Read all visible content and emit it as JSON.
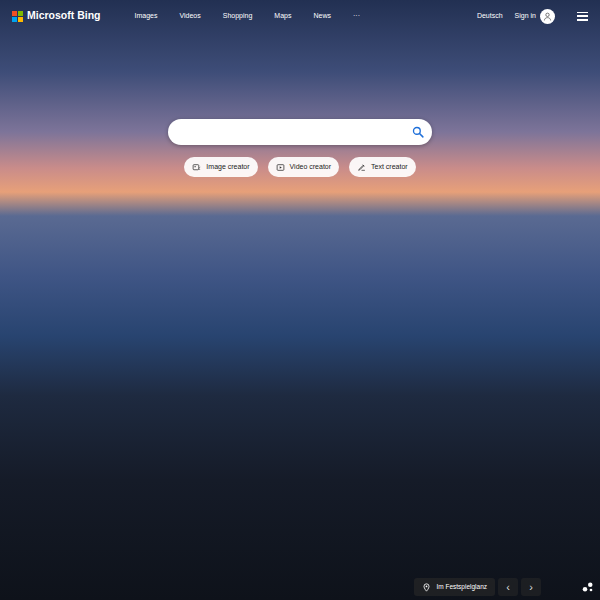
{
  "header": {
    "logo_text": "Microsoft Bing",
    "nav": [
      "Images",
      "Videos",
      "Shopping",
      "Maps",
      "News"
    ],
    "more": "···",
    "language": "Deutsch",
    "sign_in": "Sign in"
  },
  "creators": [
    "Image creator",
    "Video creator",
    "Text creator"
  ],
  "footer": {
    "caption": "Im Festspielglanz",
    "prev": "‹",
    "next": "›"
  }
}
